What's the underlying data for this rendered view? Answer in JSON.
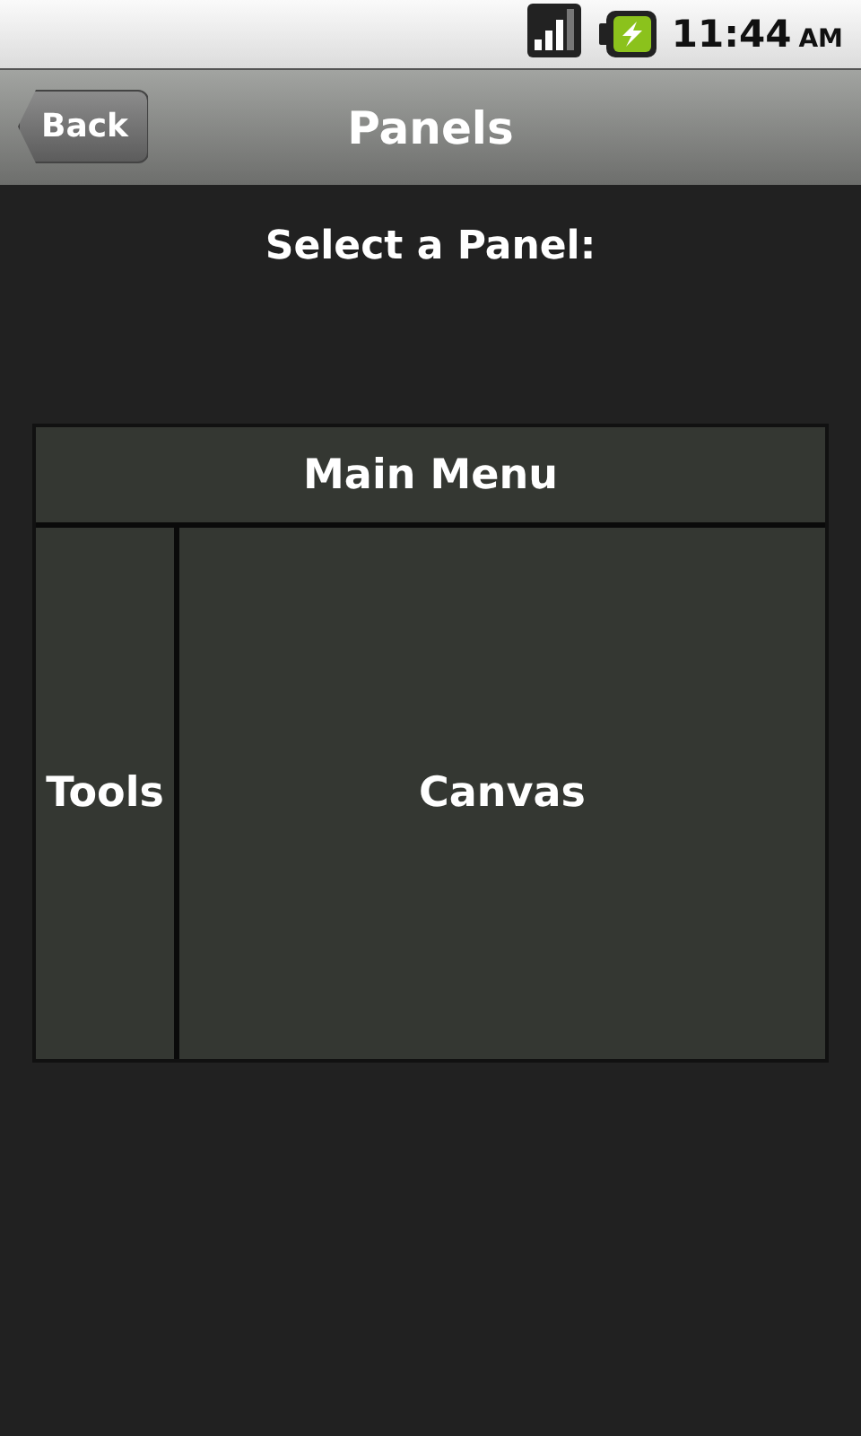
{
  "status_bar": {
    "time": "11:44",
    "period": "AM"
  },
  "title_bar": {
    "back_button": "Back",
    "title": "Panels"
  },
  "prompt": "Select a Panel:",
  "panels": {
    "top": "Main Menu",
    "left": "Tools",
    "center": "Canvas"
  }
}
